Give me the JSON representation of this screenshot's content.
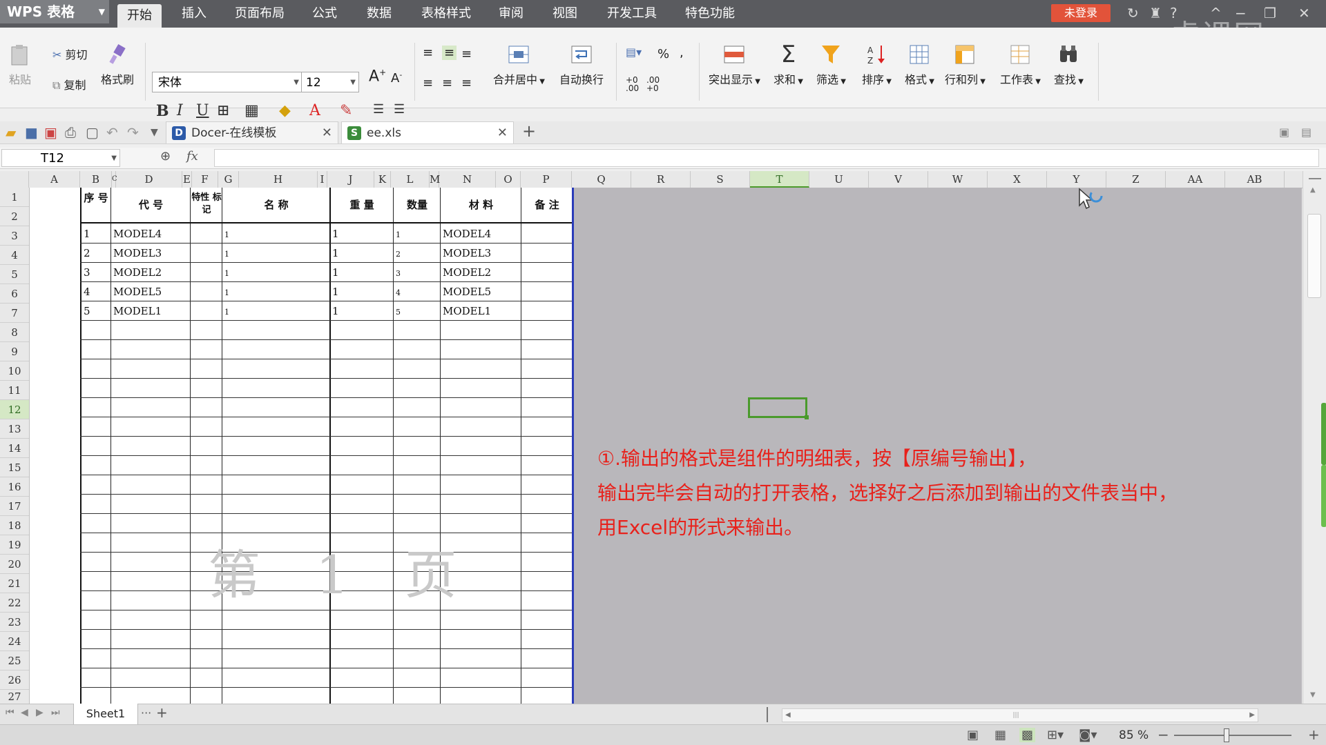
{
  "app": {
    "name": "WPS 表格",
    "login": "未登录",
    "watermark": "虎课网"
  },
  "menu": {
    "tabs": [
      "开始",
      "插入",
      "页面布局",
      "公式",
      "数据",
      "表格样式",
      "审阅",
      "视图",
      "开发工具",
      "特色功能"
    ],
    "active": "开始"
  },
  "ribbon": {
    "paste": "粘贴",
    "cut": "剪切",
    "copy": "复制",
    "format_painter": "格式刷",
    "font_name": "宋体",
    "font_size": "12",
    "bold": "B",
    "italic": "I",
    "underline": "U",
    "merge_center": "合并居中",
    "wrap_text": "自动换行",
    "percent": "%",
    "highlight": "突出显示",
    "sum": "求和",
    "filter": "筛选",
    "sort": "排序",
    "format": "格式",
    "row_col": "行和列",
    "worksheet": "工作表",
    "find": "查找"
  },
  "tabs": {
    "docer": "Docer-在线模板",
    "file": "ee.xls"
  },
  "formula_bar": {
    "name_box": "T12",
    "fx": "fx",
    "value": ""
  },
  "grid": {
    "columns": [
      "A",
      "B",
      "C",
      "D",
      "E",
      "F",
      "G",
      "H",
      "I",
      "J",
      "K",
      "L",
      "M",
      "N",
      "O",
      "P",
      "Q",
      "R",
      "S",
      "T",
      "U",
      "V",
      "W",
      "X",
      "Y",
      "Z",
      "AA",
      "AB"
    ],
    "selected_column": "T",
    "rows": [
      "1",
      "2",
      "3",
      "4",
      "5",
      "6",
      "7",
      "8",
      "9",
      "10",
      "11",
      "12",
      "13",
      "14",
      "15",
      "16",
      "17",
      "18",
      "19",
      "20",
      "21",
      "22",
      "23",
      "24",
      "25",
      "26",
      "27"
    ],
    "selected_row": "12",
    "headers": {
      "seq": "序 号",
      "code": "代 号",
      "mark": "特性 标记",
      "name": "名 称",
      "weight": "重 量",
      "qty": "数量",
      "material": "材 料",
      "remark": "备 注"
    },
    "data_rows": [
      {
        "seq": "1",
        "code": "MODEL4",
        "name": "1",
        "weight": "1",
        "qty": "1",
        "material": "MODEL4"
      },
      {
        "seq": "2",
        "code": "MODEL3",
        "name": "1",
        "weight": "1",
        "qty": "2",
        "material": "MODEL3"
      },
      {
        "seq": "3",
        "code": "MODEL2",
        "name": "1",
        "weight": "1",
        "qty": "3",
        "material": "MODEL2"
      },
      {
        "seq": "4",
        "code": "MODEL5",
        "name": "1",
        "weight": "1",
        "qty": "4",
        "material": "MODEL5"
      },
      {
        "seq": "5",
        "code": "MODEL1",
        "name": "1",
        "weight": "1",
        "qty": "5",
        "material": "MODEL1"
      }
    ],
    "page_label": "第 1 页"
  },
  "annotation": {
    "line1": "①.输出的格式是组件的明细表，按【原编号输出】，",
    "line2": "输出完毕会自动的打开表格，选择好之后添加到输出的文件表当中，",
    "line3": "用Excel的形式来输出。"
  },
  "sheets": {
    "active": "Sheet1",
    "more": "···",
    "add": "+"
  },
  "status": {
    "zoom": "85 %"
  }
}
